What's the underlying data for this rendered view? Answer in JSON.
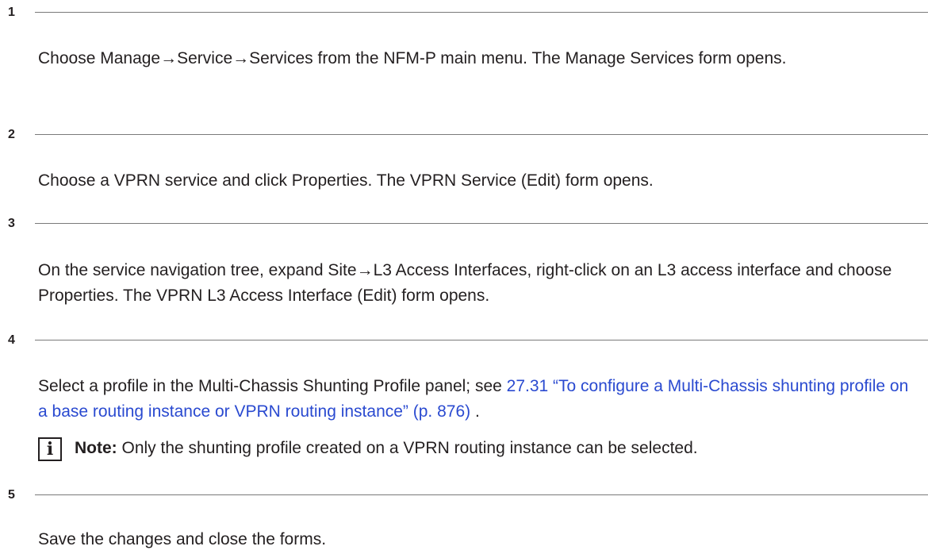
{
  "steps": [
    {
      "number": "1",
      "text": "Choose Manage→Service→Services from the NFM-P main menu. The Manage Services form opens."
    },
    {
      "number": "2",
      "text": "Choose a VPRN service and click Properties. The VPRN Service (Edit) form opens."
    },
    {
      "number": "3",
      "text": "On the service navigation tree, expand Site→L3 Access Interfaces, right-click on an L3 access interface and choose Properties. The VPRN L3 Access Interface (Edit) form opens."
    },
    {
      "number": "4",
      "text_before": "Select a profile in the Multi-Chassis Shunting Profile panel; see ",
      "link": "27.31 “To configure a Multi-Chassis shunting profile on a base routing instance or VPRN routing instance” (p. 876)",
      "text_after": " .",
      "note": {
        "icon": "info-icon",
        "icon_glyph": "i",
        "label": "Note:",
        "text": " Only the shunting profile created on a VPRN routing instance can be selected."
      }
    },
    {
      "number": "5",
      "text": "Save the changes and close the forms."
    }
  ],
  "colors": {
    "link": "#2a4ad0",
    "rule": "#7a7a7a",
    "text": "#231f20"
  }
}
